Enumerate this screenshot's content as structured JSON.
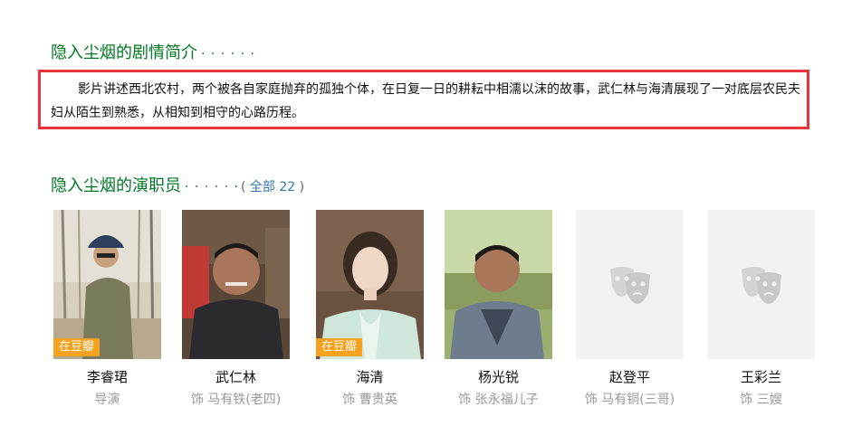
{
  "intro_section": {
    "title": "隐入尘烟的剧情简介",
    "dots": "· · · · · ·",
    "summary": "影片讲述西北农村，两个被各自家庭抛弃的孤独个体，在日复一日的耕耘中相濡以沫的故事，武仁林与海清展现了一对底层农民夫妇从陌生到熟悉，从相知到相守的心路历程。"
  },
  "cast_section": {
    "title": "隐入尘烟的演职员",
    "dots": "· · · · · ·",
    "all_open": "( ",
    "all_label": "全部 22",
    "all_close": " )"
  },
  "cast": [
    {
      "name": "李睿珺",
      "role": "导演",
      "badge": "在豆瓣",
      "photo": "person-photo"
    },
    {
      "name": "武仁林",
      "role": "饰 马有铁(老四)",
      "badge": "",
      "photo": "person-photo"
    },
    {
      "name": "海清",
      "role": "饰 曹贵英",
      "badge": "在豆瓣",
      "photo": "person-photo"
    },
    {
      "name": "杨光锐",
      "role": "饰 张永福儿子",
      "badge": "",
      "photo": "person-photo"
    },
    {
      "name": "赵登平",
      "role": "饰 马有铜(三哥)",
      "badge": "",
      "photo": "theater-mask-icon"
    },
    {
      "name": "王彩兰",
      "role": "饰 三嫂",
      "badge": "",
      "photo": "theater-mask-icon"
    }
  ],
  "colors": {
    "title_green": "#007722",
    "link_blue": "#3377aa",
    "highlight_red": "#e8343a",
    "badge_orange": "#f7a21f"
  }
}
